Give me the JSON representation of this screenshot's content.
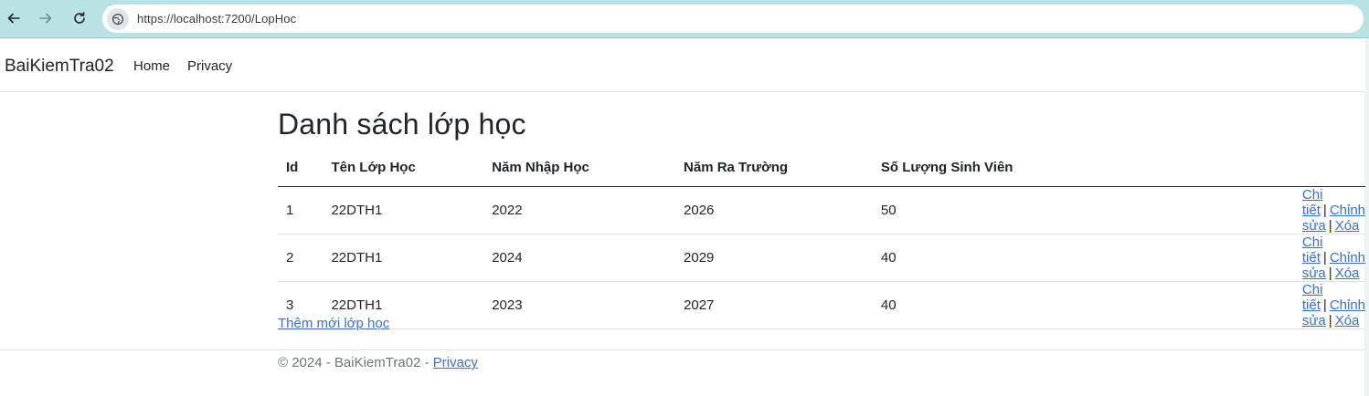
{
  "browser": {
    "url": "https://localhost:7200/LopHoc",
    "back_icon": "arrow-left-icon",
    "forward_icon": "arrow-right-icon",
    "reload_icon": "reload-icon",
    "site_icon": "globe-icon"
  },
  "navbar": {
    "brand": "BaiKiemTra02",
    "links": [
      "Home",
      "Privacy"
    ]
  },
  "main": {
    "title": "Danh sách lớp học",
    "table": {
      "headers": [
        "Id",
        "Tên Lớp Học",
        "Năm Nhập Học",
        "Năm Ra Trường",
        "Số Lượng Sinh Viên"
      ],
      "rows": [
        {
          "id": "1",
          "name": "22DTH1",
          "year_in": "2022",
          "year_out": "2026",
          "count": "50"
        },
        {
          "id": "2",
          "name": "22DTH1",
          "year_in": "2024",
          "year_out": "2029",
          "count": "40"
        },
        {
          "id": "3",
          "name": "22DTH1",
          "year_in": "2023",
          "year_out": "2027",
          "count": "40"
        }
      ],
      "actions": {
        "details": "Chi tiết",
        "edit": "Chỉnh sửa",
        "delete": "Xóa",
        "separator": "|"
      }
    },
    "create_link": "Thêm mới lớp học"
  },
  "footer": {
    "text": "© 2024 - BaiKiemTra02 -",
    "privacy": "Privacy"
  },
  "colors": {
    "browser_bar": "#b9e2e5",
    "link": "#3a6fd8",
    "text": "#212529",
    "muted": "#6c757d"
  }
}
